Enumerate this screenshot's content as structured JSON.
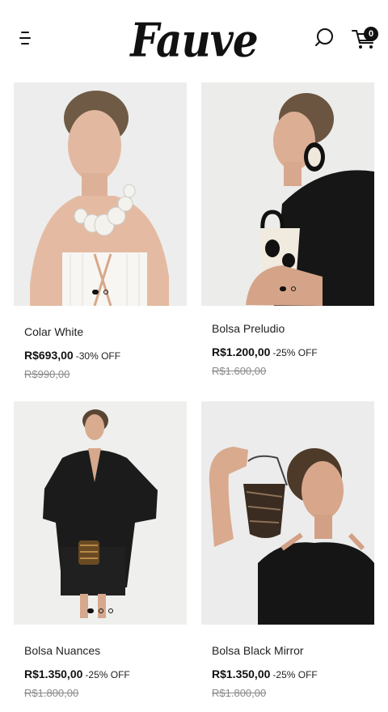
{
  "header": {
    "logo_text": "Fauve",
    "cart_count": "0",
    "icons": {
      "menu": "hamburger-menu-icon",
      "search": "search-icon",
      "cart": "cart-icon"
    }
  },
  "products": [
    {
      "name": "Colar White",
      "price": "R$693,00",
      "discount": "-30% OFF",
      "old_price": "R$990,00",
      "images_count": 2,
      "active_image": 0
    },
    {
      "name": "Bolsa Preludio",
      "price": "R$1.200,00",
      "discount": "-25% OFF",
      "old_price": "R$1.600,00",
      "images_count": 2,
      "active_image": 0
    },
    {
      "name": "Bolsa Nuances",
      "price": "R$1.350,00",
      "discount": "-25% OFF",
      "old_price": "R$1.800,00",
      "images_count": 3,
      "active_image": 0
    },
    {
      "name": "Bolsa Black Mirror",
      "price": "R$1.350,00",
      "discount": "-25% OFF",
      "old_price": "R$1.800,00",
      "images_count": 0,
      "active_image": 0
    }
  ]
}
